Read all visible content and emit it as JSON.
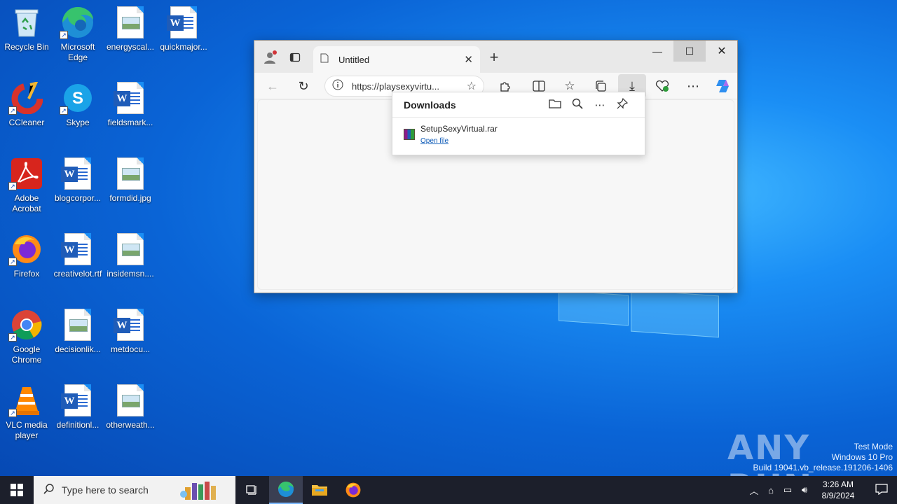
{
  "desktop": {
    "icons": [
      {
        "label": "Recycle Bin"
      },
      {
        "label": "Microsoft Edge"
      },
      {
        "label": "energyscal..."
      },
      {
        "label": "quickmajor..."
      },
      {
        "label": "CCleaner"
      },
      {
        "label": "Skype"
      },
      {
        "label": "fieldsmark..."
      },
      {
        "label": "Adobe Acrobat"
      },
      {
        "label": "blogcorpor..."
      },
      {
        "label": "formdid.jpg"
      },
      {
        "label": "Firefox"
      },
      {
        "label": "creativelot.rtf"
      },
      {
        "label": "insidemsn...."
      },
      {
        "label": "Google Chrome"
      },
      {
        "label": "decisionlik..."
      },
      {
        "label": "metdocu..."
      },
      {
        "label": "VLC media player"
      },
      {
        "label": "definitionl..."
      },
      {
        "label": "otherweath..."
      }
    ]
  },
  "browser": {
    "tab_title": "Untitled",
    "url": "https://playsexyvirtu...",
    "icons": [
      "profile-icon",
      "tab-actions-icon",
      "page-icon",
      "close-icon",
      "new-tab-icon",
      "back-icon",
      "refresh-icon",
      "info-icon",
      "star-icon",
      "extensions-icon",
      "split-screen-icon",
      "favorites-icon",
      "collections-icon",
      "download-icon",
      "browser-essentials-icon",
      "more-icon",
      "copilot-icon",
      "minimize-icon",
      "maximize-icon",
      "window-close-icon"
    ]
  },
  "downloads": {
    "title": "Downloads",
    "items": [
      {
        "filename": "SetupSexyVirtual.rar",
        "action": "Open file"
      }
    ]
  },
  "watermark": {
    "brand": "ANY RUN",
    "line1": "Test Mode",
    "line2": "Windows 10 Pro",
    "line3": "Build 19041.vb_release.191206-1406"
  },
  "taskbar": {
    "search_placeholder": "Type here to search",
    "time": "3:26 AM",
    "date": "8/9/2024"
  },
  "colors": {
    "desktop_blue": "#0a64d6",
    "taskbar": "#1c1f2b",
    "accent": "#0f5cb8"
  }
}
